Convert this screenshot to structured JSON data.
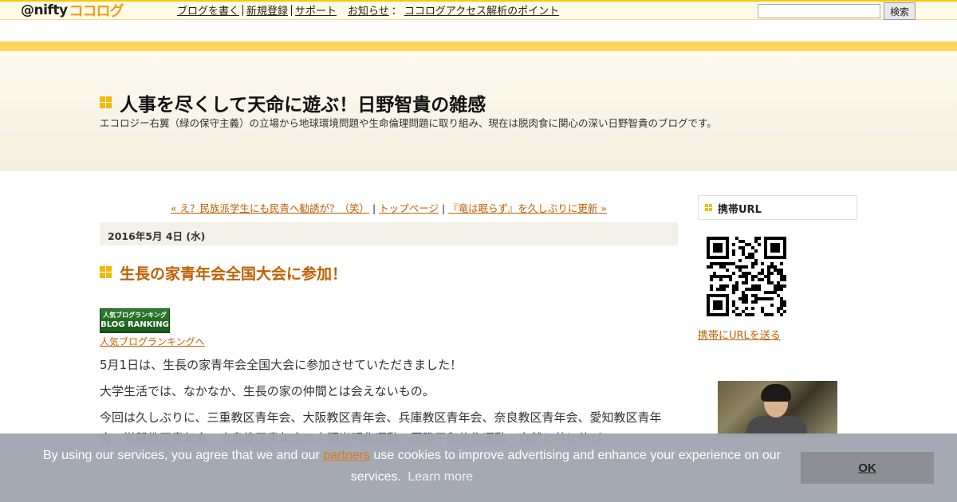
{
  "topbar": {
    "logo_prefix": "@nifty",
    "logo_brand": "ココログ",
    "nav": {
      "write_blog": "ブログを書く",
      "register": "新規登録",
      "support": "サポート",
      "news_label": "お知らせ",
      "news_colon": "：",
      "news_item": "ココログアクセス解析のポイント"
    },
    "search_button": "検索",
    "search_value": ""
  },
  "header": {
    "title": "人事を尽くして天命に遊ぶ！日野智貴の雑感",
    "description": "エコロジー右翼（緑の保守主義）の立場から地球環境問題や生命倫理問題に取り組み、現在は脱肉食に関心の深い日野智貴のブログです。"
  },
  "post_nav": {
    "prev": "« え？民族派学生にも民青へ勧誘が？（笑）",
    "sep": " | ",
    "top": "トップページ",
    "next": "『竜は眠らず』を久しぶりに更新 »"
  },
  "entry": {
    "date": "2016年5月 4日 (水)",
    "title": "生長の家青年会全国大会に参加！",
    "ranking_banner_line1": "人気ブログランキング",
    "ranking_banner_line2": "BLOG RANKING",
    "ranking_link": "人気ブログランキングへ",
    "paragraphs": [
      "5月1日は、生長の家青年会全国大会に参加させていただきました！",
      "大学生活では、なかなか、生長の家の仲間とは会えないもの。",
      "今回は久しぶりに、三重教区青年会、大阪教区青年会、兵庫教区青年会、奈良教区青年会、愛知教区青年会、滋賀教区青年会、広島教区青年会の人類光明化運動・国際平和信仰運動・自然と共に伸び"
    ]
  },
  "sidebar": {
    "mobile_title": "携帯URL",
    "send_url_link": "携帯にURLを送る"
  },
  "cookie": {
    "text_before": "By using our services, you agree that we and our ",
    "partners_link": "partners",
    "text_after": " use cookies to improve advertising and enhance your experience on our services.",
    "learn_more": "Learn more",
    "ok_button": "OK"
  },
  "colors": {
    "accent_yellow": "#f0b90b",
    "link_orange": "#c06000",
    "cookie_bg": "#a1a6b0"
  }
}
